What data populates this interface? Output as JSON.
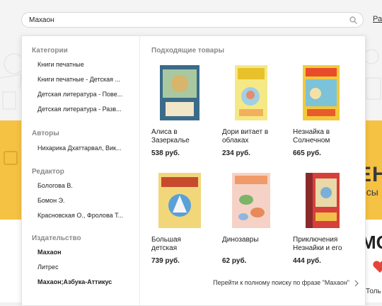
{
  "search": {
    "value": "Махаон"
  },
  "top_link": "Рас",
  "background": {
    "banner_big": "ЕН",
    "banner_small": "осы",
    "right_word": "МО",
    "right_small": "Толь"
  },
  "left": {
    "categories_title": "Категории",
    "categories": [
      "Книги печатные",
      "Книги печатные - Детская ...",
      "Детская литература - Пове...",
      "Детская литература - Разв..."
    ],
    "authors_title": "Авторы",
    "authors": [
      "Нихарика Дхаттарвал, Вик..."
    ],
    "editors_title": "Редактор",
    "editors": [
      "Бологова В.",
      "Бомон Э.",
      "Красновская О., Фролова Т..."
    ],
    "publishers_title": "Издательство",
    "publishers": [
      {
        "label": "Махаон",
        "bold": true
      },
      {
        "label": "Литрес",
        "bold": false
      },
      {
        "label": "Махаон;Азбука-Аттикус",
        "bold": true
      }
    ]
  },
  "right": {
    "title": "Подходящие товары",
    "products": [
      {
        "name": "Алиса в Зазеркалье",
        "price": "538 руб.",
        "cover_color": "#3a6b8a"
      },
      {
        "name": "Дори витает в облаках",
        "price": "234 руб.",
        "cover_color": "#e9d64a"
      },
      {
        "name": "Незнайка в Солнечном",
        "price": "665 руб.",
        "cover_color": "#f3c93c"
      },
      {
        "name": "Большая детская",
        "price": "739 руб.",
        "cover_color": "#c84a2e"
      },
      {
        "name": "Динозавры",
        "price": "62 руб.",
        "cover_color": "#f0a38a"
      },
      {
        "name": "Приключения Незнайки и его",
        "price": "444 руб.",
        "cover_color": "#d7403a"
      }
    ],
    "full_search": "Перейти к полному поиску по фразе \"Махаон\""
  }
}
